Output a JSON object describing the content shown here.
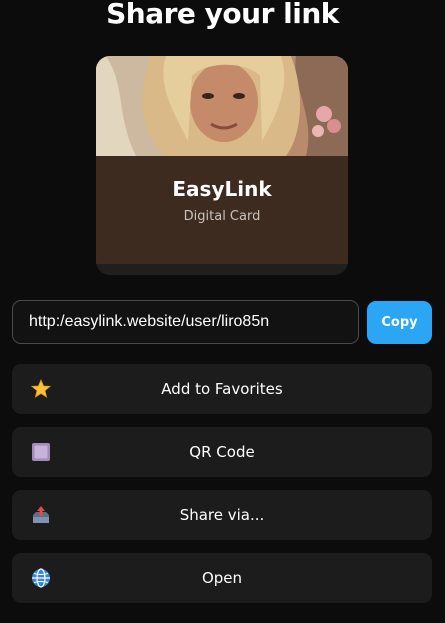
{
  "header": {
    "title": "Share your link"
  },
  "card": {
    "name": "EasyLink",
    "subtitle": "Digital Card",
    "photo_icon": "profile-photo"
  },
  "link": {
    "url": "http:/easylink.website/user/liro85n",
    "copy_label": "Copy"
  },
  "actions": [
    {
      "label": "Add to Favorites",
      "icon": "star-icon"
    },
    {
      "label": "QR Code",
      "icon": "qr-square-icon"
    },
    {
      "label": "Share via...",
      "icon": "outbox-tray-icon"
    },
    {
      "label": "Open",
      "icon": "globe-icon"
    }
  ],
  "colors": {
    "background": "#0c0c0c",
    "accent": "#2aa6f5",
    "card_body": "#3c2b1e",
    "action_bg": "#1c1c1c"
  }
}
